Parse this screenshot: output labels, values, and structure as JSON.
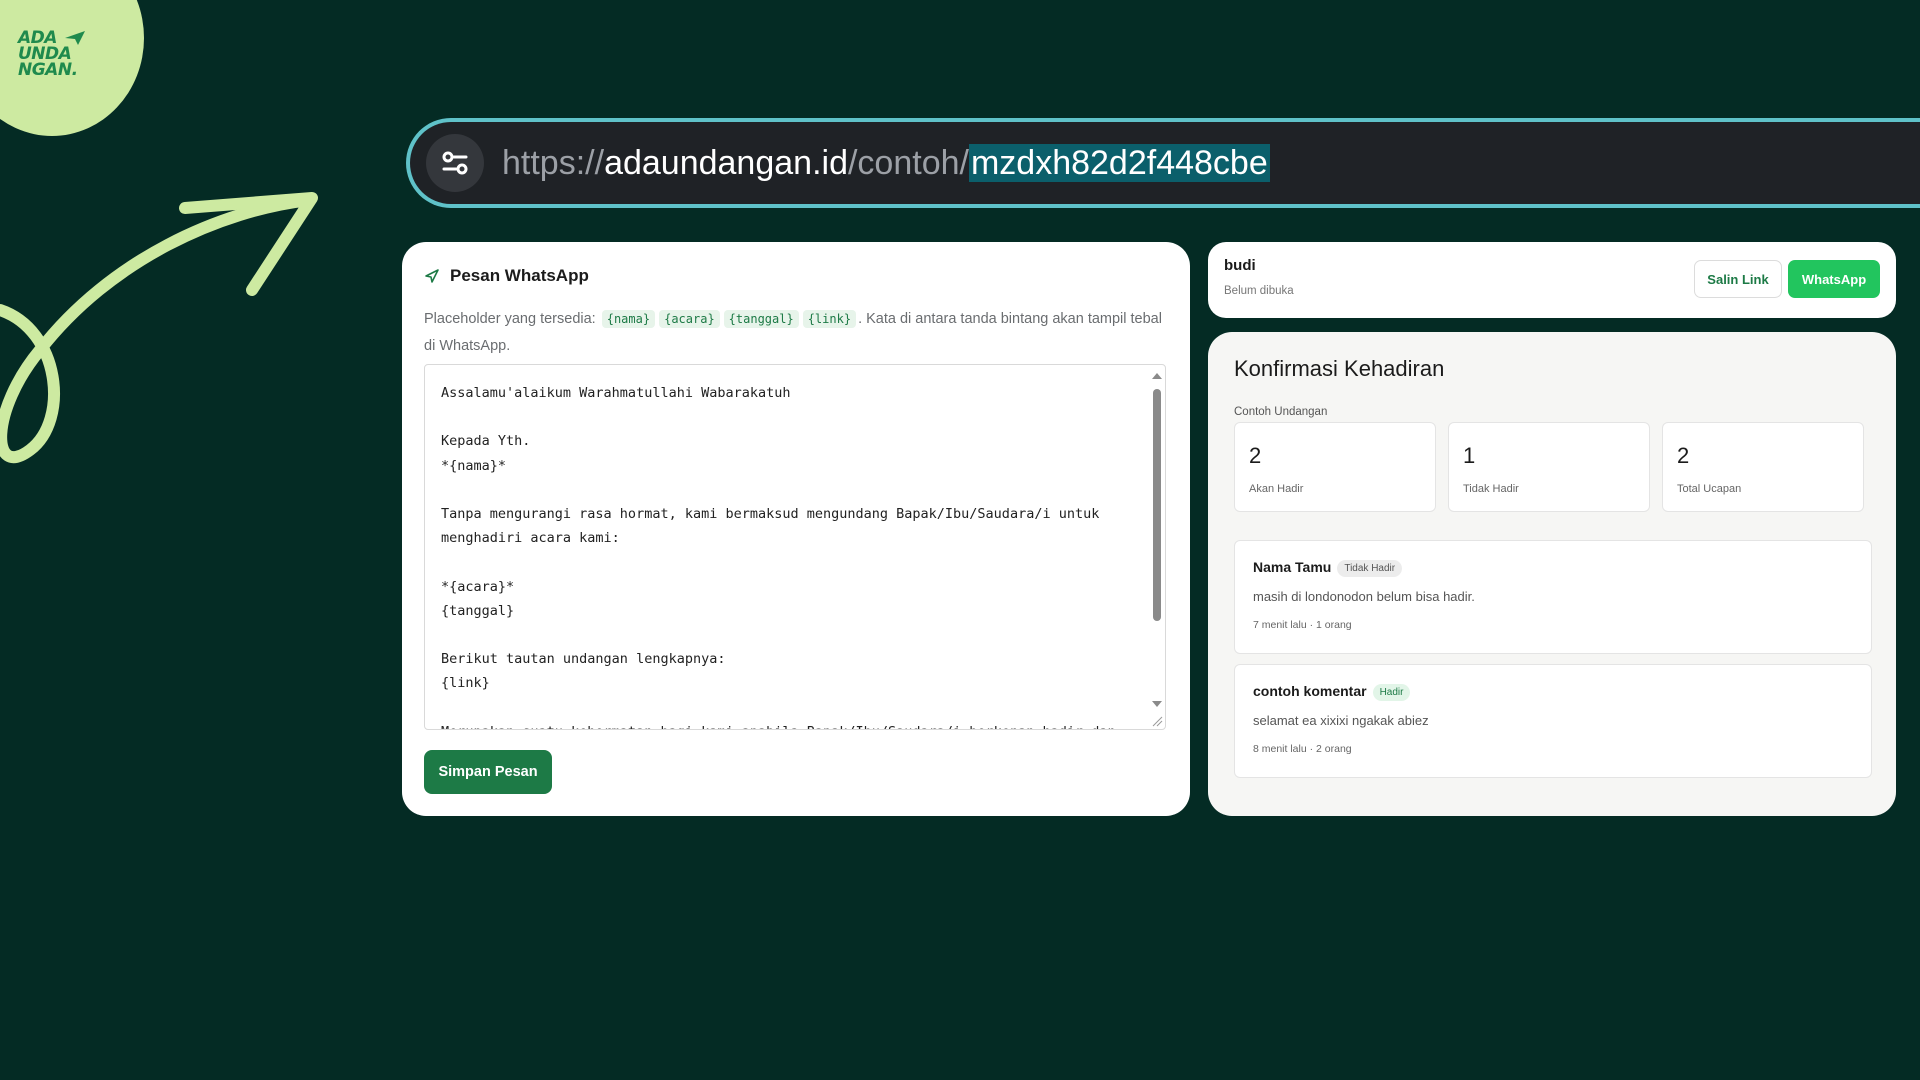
{
  "logo": {
    "line1": "ADA",
    "line2": "UNDA",
    "line3": "NGAN."
  },
  "urlbar": {
    "scheme": "https://",
    "host": "adaundangan.id",
    "path": "/contoh/",
    "selected": "mzdxh82d2f448cbe",
    "icon": "site-settings-icon"
  },
  "whatsapp_card": {
    "icon": "send-icon",
    "title": "Pesan WhatsApp",
    "placeholder_intro": "Placeholder yang tersedia:",
    "placeholders": [
      "{nama}",
      "{acara}",
      "{tanggal}",
      "{link}"
    ],
    "placeholder_note": ". Kata di antara tanda bintang akan tampil tebal di WhatsApp.",
    "message": "Assalamu'alaikum Warahmatullahi Wabarakatuh\n\nKepada Yth.\n*{nama}*\n\nTanpa mengurangi rasa hormat, kami bermaksud mengundang Bapak/Ibu/Saudara/i untuk menghadiri acara kami:\n\n*{acara}*\n{tanggal}\n\nBerikut tautan undangan lengkapnya:\n{link}\n\nMerupakan suatu kehormatan bagi kami apabila Bapak/Ibu/Saudara/i berkenan hadir dan",
    "save_label": "Simpan Pesan"
  },
  "guest_card": {
    "name": "budi",
    "status": "Belum dibuka",
    "copy_label": "Salin Link",
    "whatsapp_label": "WhatsApp"
  },
  "rsvp_card": {
    "title": "Konfirmasi Kehadiran",
    "subtitle": "Contoh  Undangan",
    "stats": [
      {
        "value": "2",
        "label": "Akan Hadir"
      },
      {
        "value": "1",
        "label": "Tidak Hadir"
      },
      {
        "value": "2",
        "label": "Total Ucapan"
      }
    ],
    "comments": [
      {
        "name": "Nama Tamu",
        "badge": "Tidak Hadir",
        "text": "masih di londonodon belum bisa hadir.",
        "meta": "7 menit lalu · 1 orang"
      },
      {
        "name": "contoh komentar",
        "badge": "Hadir",
        "text": "selamat ea xixixi ngakak abiez",
        "meta": "8 menit lalu · 2 orang"
      }
    ]
  },
  "colors": {
    "background": "#042b24",
    "logo_blob": "#cdeaa1",
    "url_border": "#5fc2c9",
    "primary_green": "#1d7a46",
    "whatsapp_green": "#22c55e"
  }
}
